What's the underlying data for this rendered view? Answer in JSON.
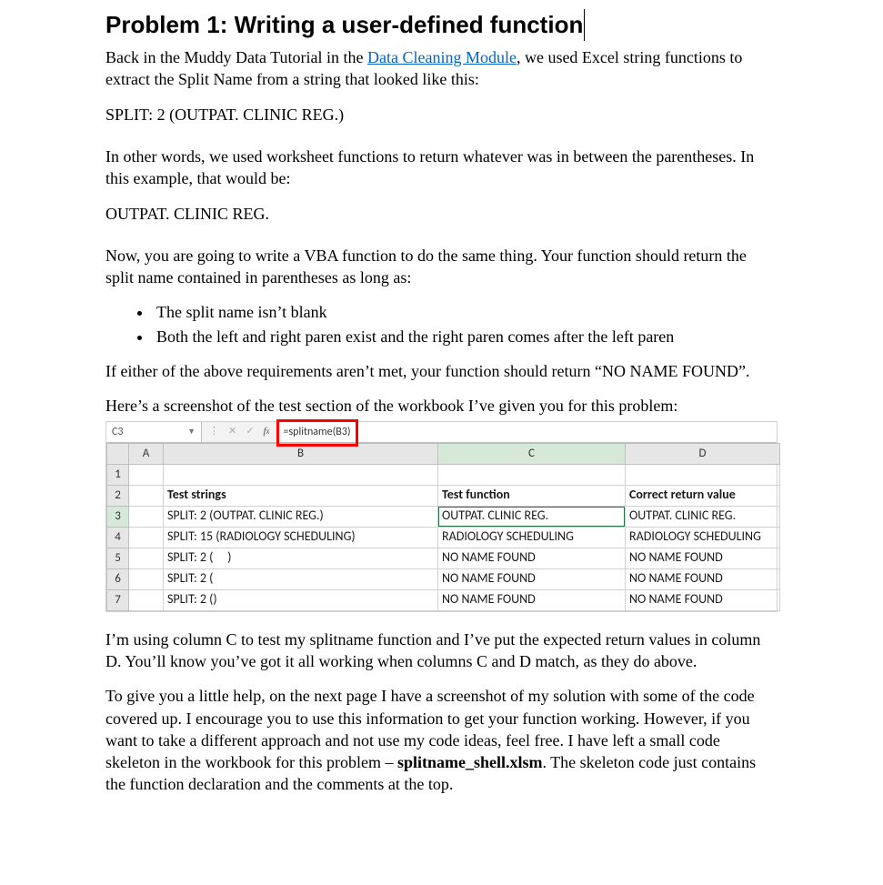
{
  "heading": "Problem 1: Writing a user-defined function",
  "intro_prefix": "Back in the Muddy Data Tutorial in the ",
  "intro_link_text": "Data Cleaning Module",
  "intro_suffix": ", we used Excel string functions to extract the Split Name from a string that looked like this:",
  "sample_string": "SPLIT: 2 (OUTPAT. CLINIC REG.)",
  "after_sample": "In other words, we used worksheet functions to return whatever was in between the parentheses. In this example, that would be:",
  "extracted_value": "OUTPAT. CLINIC REG.",
  "task_intro": "Now, you are going to write a VBA function to do the same thing. Your function should return the split name contained in parentheses as long as:",
  "bullets": {
    "b1": "The split name isn’t blank",
    "b2": "Both the left and right paren exist and the right paren comes after the left paren"
  },
  "error_rule": "If either of the above requirements aren’t met, your function should return “NO NAME FOUND”.",
  "screenshot_intro": "Here’s a screenshot of the test section of the workbook I’ve given you for this problem:",
  "excel": {
    "namebox": "C3",
    "formula": "=splitname(B3)",
    "col_headers": {
      "a": "A",
      "b": "B",
      "c": "C",
      "d": "D"
    },
    "row_labels": {
      "r1": "1",
      "r2": "2",
      "r3": "3",
      "r4": "4",
      "r5": "5",
      "r6": "6",
      "r7": "7"
    },
    "header_row": {
      "b": "Test strings",
      "c": "Test function",
      "d": "Correct return value"
    },
    "data": {
      "r3": {
        "b": "SPLIT: 2 (OUTPAT. CLINIC REG.)",
        "c": "OUTPAT. CLINIC REG.",
        "d": "OUTPAT. CLINIC REG."
      },
      "r4": {
        "b": "SPLIT: 15 (RADIOLOGY SCHEDULING)",
        "c": "RADIOLOGY SCHEDULING",
        "d": "RADIOLOGY SCHEDULING"
      },
      "r5": {
        "b": "SPLIT: 2 (     )",
        "c": "NO NAME FOUND",
        "d": "NO NAME FOUND"
      },
      "r6": {
        "b": "SPLIT: 2 (",
        "c": "NO NAME FOUND",
        "d": "NO NAME FOUND"
      },
      "r7": {
        "b": "SPLIT: 2 ()",
        "c": "NO NAME FOUND",
        "d": "NO NAME FOUND"
      }
    }
  },
  "after_excel_1": "I’m using column C to test my splitname function and I’ve put the expected return values in column D. You’ll know you’ve got it all working when columns C and D match, as they do above.",
  "help_prefix": "To give you a little help, on the next page I have a screenshot of my solution with some of the code covered up. I encourage you to use this information to get your function working. However, if you want to take a different approach and not use my code ideas, feel free. I have left a small code skeleton in the workbook for this problem – ",
  "help_filename": "splitname_shell.xlsm",
  "help_suffix": ". The skeleton code just contains the function declaration and the comments at the top."
}
